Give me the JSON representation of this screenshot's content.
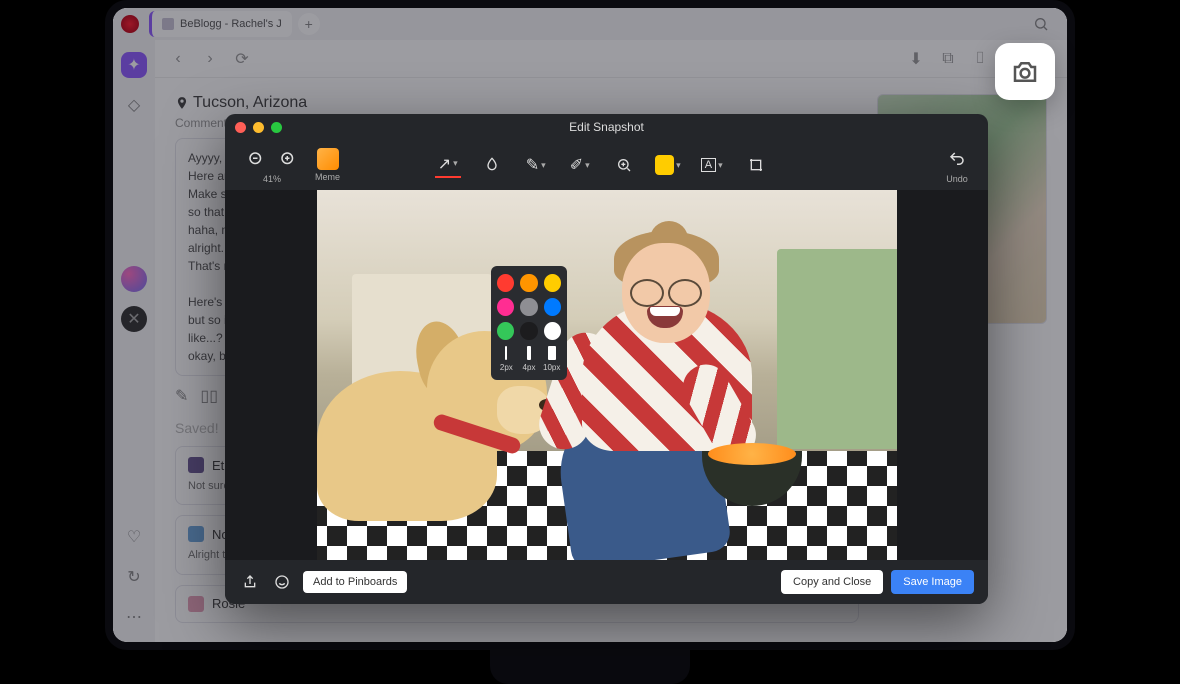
{
  "browser": {
    "tab_title": "BeBlogg - Rachel's J",
    "new_tab": "+"
  },
  "nav": {
    "back": "‹",
    "forward": "›",
    "reload": "⟳"
  },
  "post": {
    "location_label": "Tucson, Arizona",
    "comments_label": "Comments:",
    "body_line1": "Ayyyy, gu",
    "body_line2": "Here are",
    "body_line3": "Make sur",
    "body_line4": "so that I l",
    "body_line5": "haha, not",
    "body_line6": "alright... S",
    "body_line7": "That's rig",
    "body_line8": "Here's th",
    "body_line9": "but so is",
    "body_line10": "like...? Ma",
    "body_line11": "okay, bye",
    "saved_label": "Saved!"
  },
  "drafts": [
    {
      "title": "Etha",
      "body": "Not sure\nand I will"
    },
    {
      "title": "Noe",
      "body": "Alright th\nsoooo, ou"
    },
    {
      "title": "Rosie",
      "body": ""
    }
  ],
  "editor": {
    "title": "Edit Snapshot",
    "zoom_label": "41%",
    "meme_label": "Meme",
    "undo_label": "Undo",
    "pinboards_btn": "Add to Pinboards",
    "copy_close_btn": "Copy and Close",
    "save_btn": "Save Image",
    "palette": {
      "colors": [
        "#ff3b30",
        "#ff9500",
        "#ffcc00",
        "#ff2d92",
        "#8e8e93",
        "#007aff",
        "#34c759",
        "#1c1c1e",
        "#ffffff"
      ],
      "strokes": [
        {
          "label": "2px",
          "w": 2
        },
        {
          "label": "4px",
          "w": 4
        },
        {
          "label": "10px",
          "w": 8
        }
      ]
    }
  }
}
